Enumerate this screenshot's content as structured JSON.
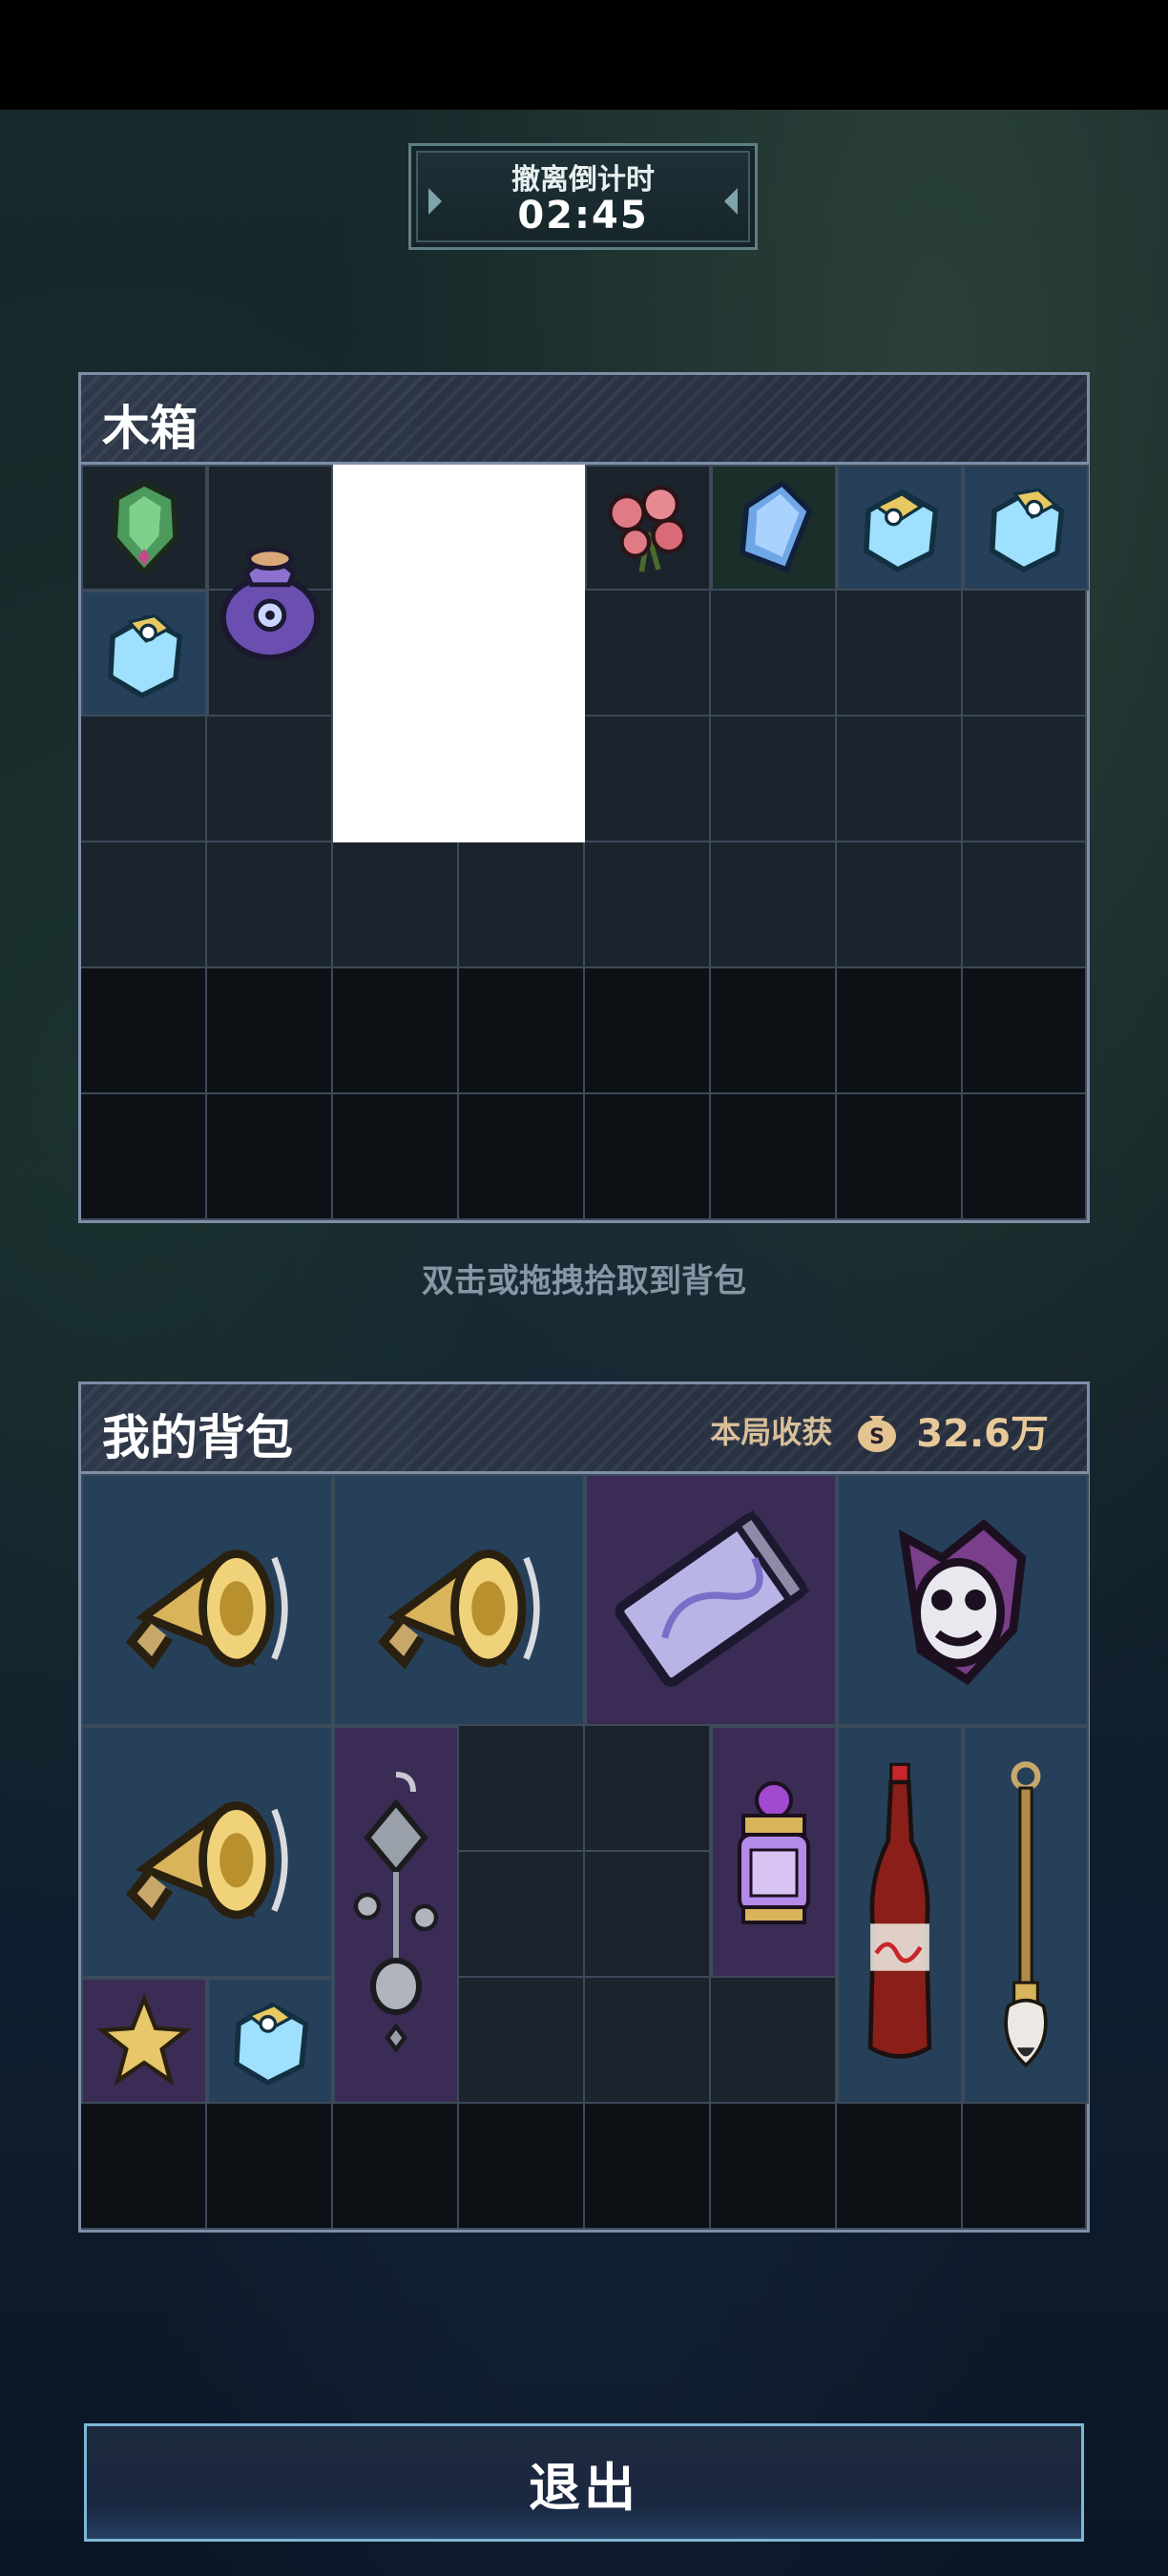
{
  "timer": {
    "label": "撤离倒计时",
    "value": "02:45"
  },
  "crate": {
    "title": "木箱",
    "items": [
      {
        "name": "green-gem-icon",
        "bg": "grey"
      },
      {
        "name": "purple-pouch-icon",
        "bg": "green"
      },
      {
        "name": "loading-item-placeholder",
        "bg": "white"
      },
      {
        "name": "rose-bouquet-icon",
        "bg": "grey"
      },
      {
        "name": "blue-crystal-icon",
        "bg": "green"
      },
      {
        "name": "ice-cube-icon",
        "bg": "blue"
      },
      {
        "name": "ice-cube-icon",
        "bg": "blue"
      },
      {
        "name": "ice-cube-icon",
        "bg": "blue"
      }
    ]
  },
  "hint": "双击或拖拽拾取到背包",
  "backpack": {
    "title": "我的背包",
    "loot_label": "本局收获",
    "loot_value": "32.6万",
    "items": [
      {
        "name": "gold-gramophone-icon",
        "bg": "blue"
      },
      {
        "name": "gold-gramophone-icon",
        "bg": "blue"
      },
      {
        "name": "purple-ticket-icon",
        "bg": "purple"
      },
      {
        "name": "clown-mask-icon",
        "bg": "blue"
      },
      {
        "name": "gold-gramophone-icon",
        "bg": "blue"
      },
      {
        "name": "silver-earring-icon",
        "bg": "purple"
      },
      {
        "name": "purple-potion-jar-icon",
        "bg": "purple"
      },
      {
        "name": "cola-bottle-icon",
        "bg": "blue"
      },
      {
        "name": "calligraphy-brush-icon",
        "bg": "blue"
      },
      {
        "name": "gold-star-icon",
        "bg": "purple"
      },
      {
        "name": "ice-cube-icon",
        "bg": "blue"
      }
    ]
  },
  "exit_button": {
    "label": "退出"
  },
  "colors": {
    "panel_border": "#7d8ea8",
    "loot_gold": "#e7c99a",
    "exit_border": "#7fb7d6"
  }
}
